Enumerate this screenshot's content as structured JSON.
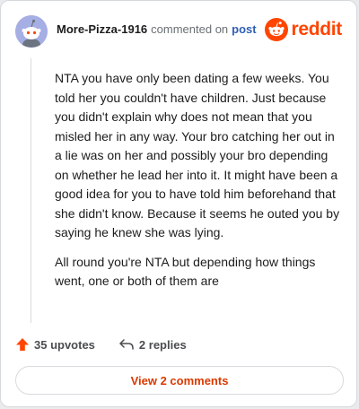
{
  "comment": {
    "username": "More-Pizza-1916",
    "action": "commented on",
    "post_link": "post",
    "paragraphs": [
      "NTA you have only been dating a few weeks. You told her you couldn't have children. Just because you didn't explain why does not mean that you misled her in any way. Your bro catching her out in a lie was on her and possibly your bro depending on whether he lead her into it. It might have been a good idea for you to have told him beforehand that she didn't know. Because it seems he outed you by saying he knew she was lying.",
      "All round you're NTA but depending how things went, one or both of them are"
    ]
  },
  "brand": {
    "name": "reddit",
    "icon": "reddit-alien-icon",
    "color": "#ff4500"
  },
  "footer": {
    "upvotes": "35 upvotes",
    "replies": "2 replies",
    "view_comments": "View 2 comments"
  },
  "colors": {
    "accent": "#ff4500",
    "link": "#2f5fb5",
    "button_text": "#d93a00",
    "avatar_bg": "#a6afe4"
  }
}
